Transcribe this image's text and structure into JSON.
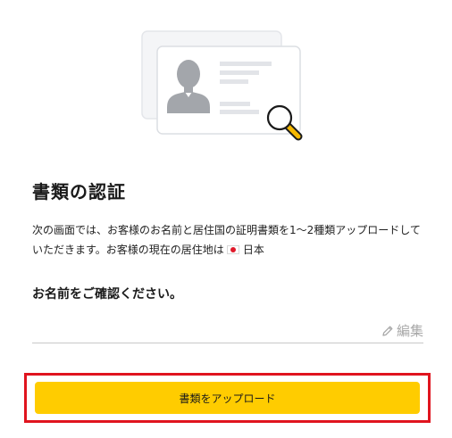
{
  "page": {
    "title": "書類の認証",
    "description_prefix": "次の画面では、お客様のお名前と居住国の証明書類を1～2種類アップロードしていただきます。お客様の現在の居住地は",
    "residence_country": "日本",
    "name_heading": "お名前をご確認ください。",
    "edit_label": "編集",
    "upload_button_label": "書類をアップロード"
  },
  "icons": {
    "illustration": "id-card-with-magnifier-icon",
    "edit": "pencil-icon",
    "flag": "japan-flag-icon"
  },
  "colors": {
    "accent": "#ffcc00",
    "highlight_frame": "#e0141e",
    "muted_text": "#a8a8a8",
    "magnifier_handle": "#f5b800"
  }
}
